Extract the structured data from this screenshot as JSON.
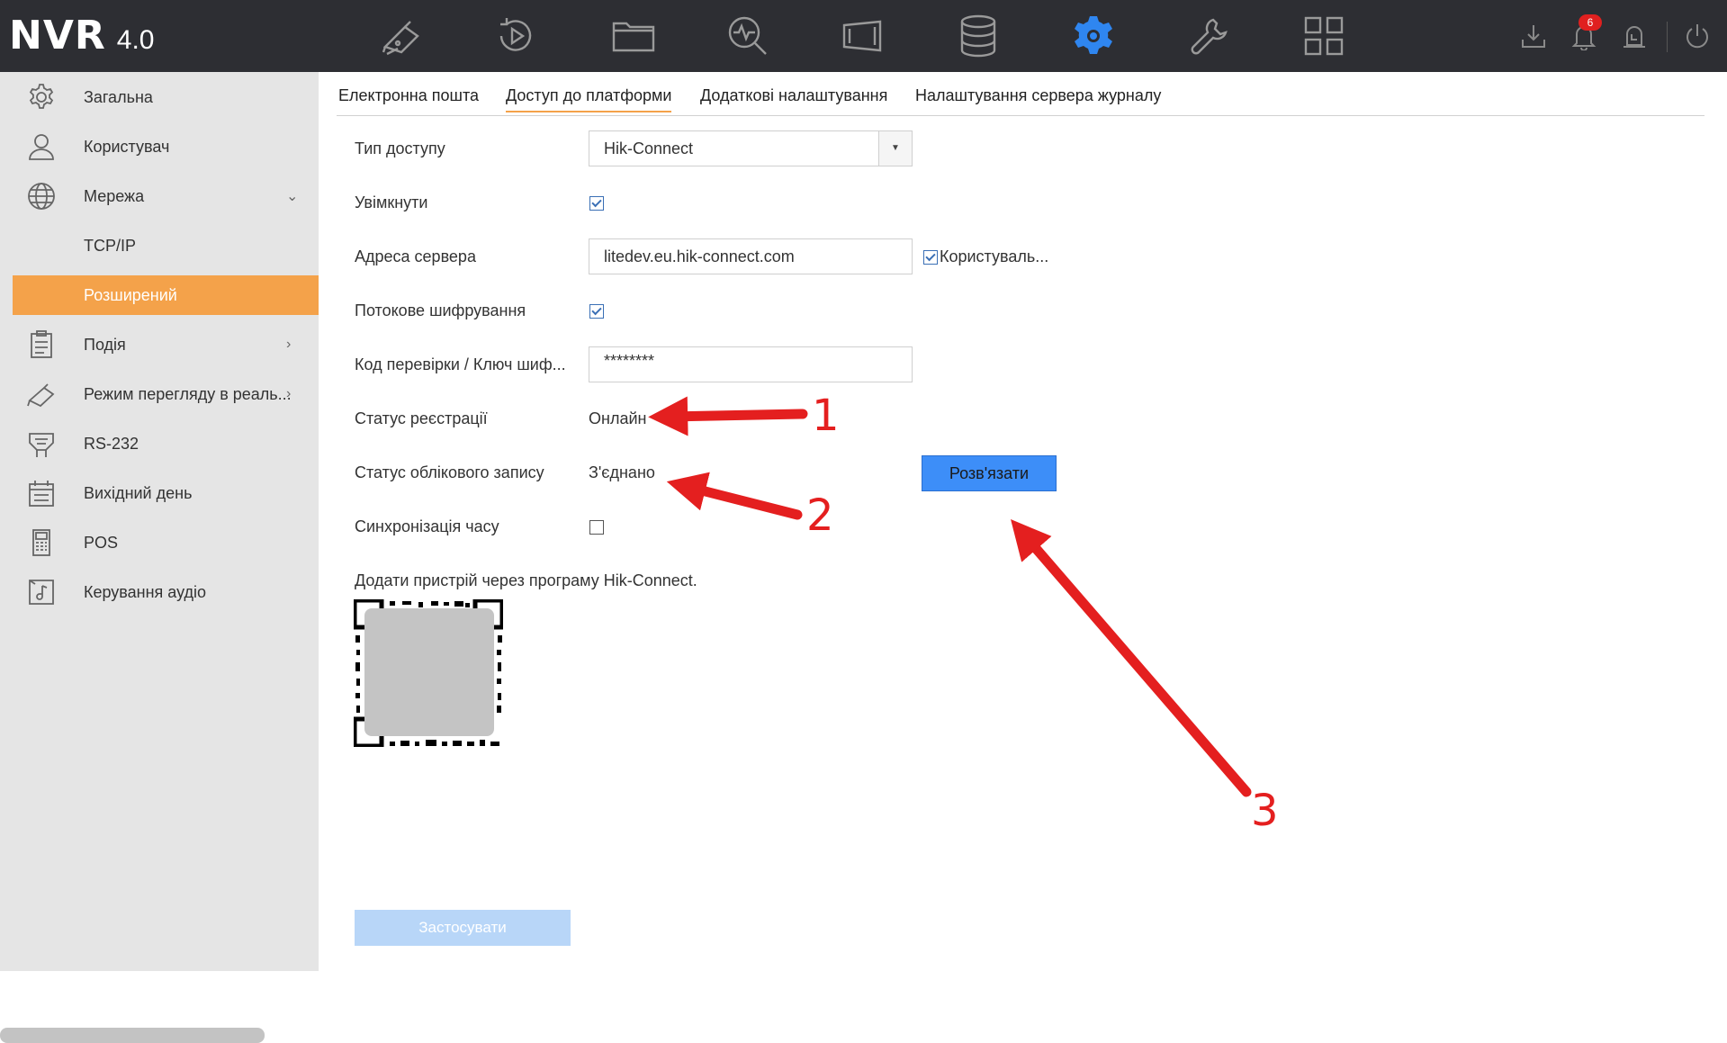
{
  "app": {
    "brand": "NVR",
    "version": "4.0"
  },
  "topbar": {
    "nav_icons": [
      "live-view-camera-icon",
      "playback-icon",
      "file-folder-icon",
      "smart-search-icon",
      "video-wall-icon",
      "storage-database-icon",
      "settings-gear-icon",
      "maintenance-wrench-icon",
      "layout-grid-icon"
    ],
    "active_icon": "settings-gear-icon",
    "right_icons": [
      "download-icon",
      "notification-bell-icon",
      "alarm-icon",
      "power-icon"
    ],
    "notification_count": "6",
    "accent_color": "#2f86f0"
  },
  "sidebar": {
    "items": [
      {
        "label": "Загальна",
        "icon": "gear-icon"
      },
      {
        "label": "Користувач",
        "icon": "user-icon"
      },
      {
        "label": "Мережа",
        "icon": "globe-icon",
        "expandable": true
      },
      {
        "label": "TCP/IP",
        "sub": true
      },
      {
        "label": "Розширений",
        "sub": true,
        "active": true
      },
      {
        "label": "Подія",
        "icon": "event-clipboard-icon",
        "expandable": true
      },
      {
        "label": "Режим перегляду в реаль...",
        "icon": "camera-icon",
        "expandable": true
      },
      {
        "label": "RS-232",
        "icon": "rs232-icon"
      },
      {
        "label": "Вихідний день",
        "icon": "calendar-icon"
      },
      {
        "label": "POS",
        "icon": "pos-icon"
      },
      {
        "label": "Керування аудіо",
        "icon": "audio-icon"
      }
    ],
    "active_color": "#f4a24a"
  },
  "tabs": [
    {
      "label": "Електронна пошта"
    },
    {
      "label": "Доступ до платформи",
      "active": true
    },
    {
      "label": "Додаткові налаштування"
    },
    {
      "label": "Налаштування сервера журналу"
    }
  ],
  "form": {
    "access_type": {
      "label": "Тип доступу",
      "value": "Hik-Connect"
    },
    "enable": {
      "label": "Увімкнути",
      "checked": true
    },
    "server_address": {
      "label": "Адреса сервера",
      "value": "litedev.eu.hik-connect.com",
      "custom_label": "Користуваль...",
      "custom_checked": true
    },
    "stream_encryption": {
      "label": "Потокове шифрування",
      "checked": true
    },
    "verification_code": {
      "label": "Код перевірки / Ключ шиф...",
      "value": "********"
    },
    "registration_status": {
      "label": "Статус реєстрації",
      "value": "Онлайн"
    },
    "account_status": {
      "label": "Статус облікового запису",
      "value": "З'єднано"
    },
    "unbind_label": "Розв'язати",
    "time_sync": {
      "label": "Синхронізація часу",
      "checked": false
    },
    "add_device_text": "Додати пристрій через програму Hik-Connect."
  },
  "apply_label": "Застосувати",
  "annotations": {
    "color": "#e41f1f",
    "numbers": [
      "1",
      "2",
      "3"
    ]
  }
}
